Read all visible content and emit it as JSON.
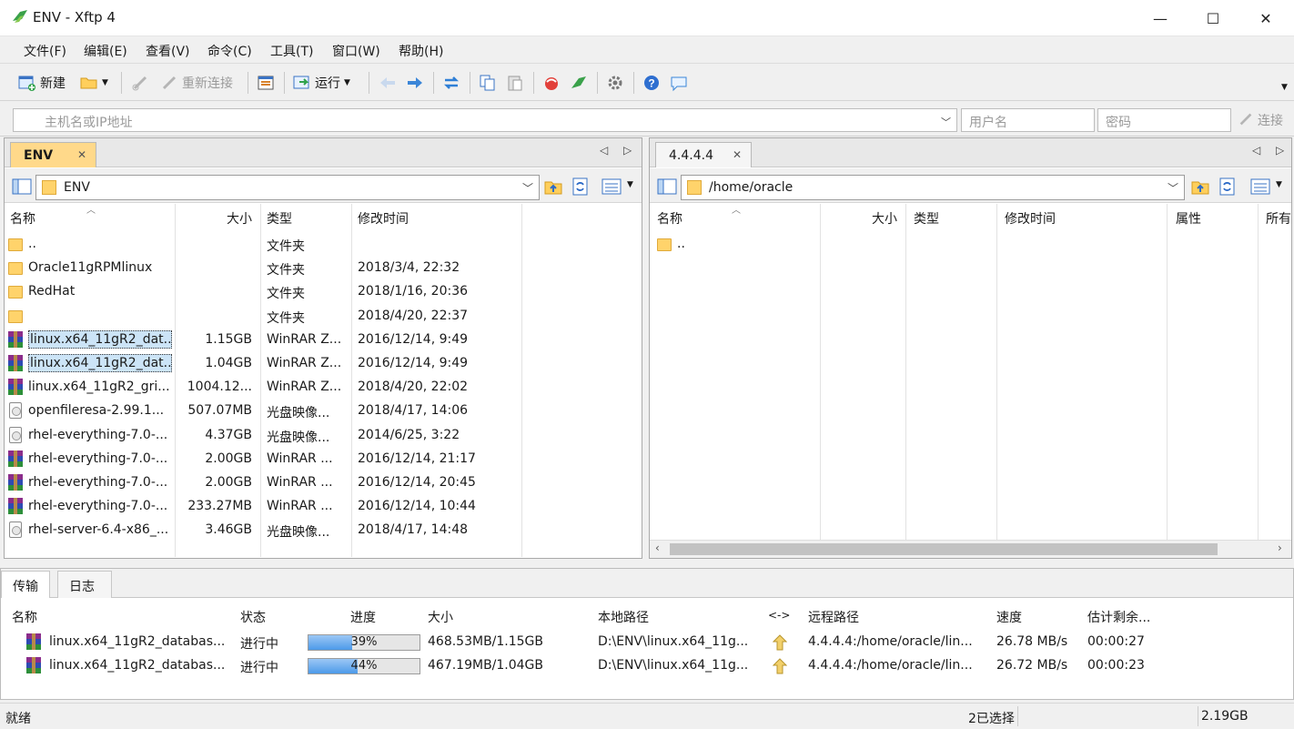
{
  "window": {
    "title": "ENV - Xftp 4",
    "minimize": "—",
    "maximize": "☐",
    "close": "✕"
  },
  "menu": [
    "文件(F)",
    "编辑(E)",
    "查看(V)",
    "命令(C)",
    "工具(T)",
    "窗口(W)",
    "帮助(H)"
  ],
  "toolbar": {
    "new_label": "新建",
    "reconnect_label": "重新连接",
    "run_label": "运行"
  },
  "address": {
    "host_placeholder": "主机名或IP地址",
    "user_placeholder": "用户名",
    "password_placeholder": "密码",
    "connect_label": "连接"
  },
  "left_pane": {
    "tab_label": "ENV",
    "path": "ENV",
    "columns": [
      "名称",
      "大小",
      "类型",
      "修改时间"
    ],
    "rows": [
      {
        "icon": "folder",
        "name": "..",
        "size": "",
        "type": "文件夹",
        "mtime": ""
      },
      {
        "icon": "folder",
        "name": "Oracle11gRPMlinux",
        "size": "",
        "type": "文件夹",
        "mtime": "2018/3/4, 22:32"
      },
      {
        "icon": "folder",
        "name": "RedHat",
        "size": "",
        "type": "文件夹",
        "mtime": "2018/1/16, 20:36"
      },
      {
        "icon": "folder",
        "name": "",
        "size": "",
        "type": "文件夹",
        "mtime": "2018/4/20, 22:37"
      },
      {
        "icon": "rar",
        "name": "linux.x64_11gR2_dat...",
        "size": "1.15GB",
        "type": "WinRAR Z...",
        "mtime": "2016/12/14, 9:49"
      },
      {
        "icon": "rar",
        "name": "linux.x64_11gR2_dat...",
        "size": "1.04GB",
        "type": "WinRAR Z...",
        "mtime": "2016/12/14, 9:49"
      },
      {
        "icon": "rar",
        "name": "linux.x64_11gR2_gri...",
        "size": "1004.12...",
        "type": "WinRAR Z...",
        "mtime": "2018/4/20, 22:02"
      },
      {
        "icon": "iso",
        "name": "openfileresa-2.99.1...",
        "size": "507.07MB",
        "type": "光盘映像...",
        "mtime": "2018/4/17, 14:06"
      },
      {
        "icon": "iso",
        "name": "rhel-everything-7.0-...",
        "size": "4.37GB",
        "type": "光盘映像...",
        "mtime": "2014/6/25, 3:22"
      },
      {
        "icon": "rar",
        "name": "rhel-everything-7.0-...",
        "size": "2.00GB",
        "type": "WinRAR ...",
        "mtime": "2016/12/14, 21:17"
      },
      {
        "icon": "rar",
        "name": "rhel-everything-7.0-...",
        "size": "2.00GB",
        "type": "WinRAR ...",
        "mtime": "2016/12/14, 20:45"
      },
      {
        "icon": "rar",
        "name": "rhel-everything-7.0-...",
        "size": "233.27MB",
        "type": "WinRAR ...",
        "mtime": "2016/12/14, 10:44"
      },
      {
        "icon": "iso",
        "name": "rhel-server-6.4-x86_...",
        "size": "3.46GB",
        "type": "光盘映像...",
        "mtime": "2018/4/17, 14:48"
      }
    ]
  },
  "right_pane": {
    "tab_label": "4.4.4.4",
    "path": "/home/oracle",
    "columns": [
      "名称",
      "大小",
      "类型",
      "修改时间",
      "属性",
      "所有"
    ],
    "rows": [
      {
        "icon": "folder",
        "name": ".."
      }
    ]
  },
  "transfer": {
    "tabs": [
      "传输",
      "日志"
    ],
    "columns": [
      "名称",
      "状态",
      "进度",
      "大小",
      "本地路径",
      "<->",
      "远程路径",
      "速度",
      "估计剩余..."
    ],
    "rows": [
      {
        "name": "linux.x64_11gR2_databas...",
        "status": "进行中",
        "progress_pct": 39,
        "progress_label": "39%",
        "size": "468.53MB/1.15GB",
        "local": "D:\\ENV\\linux.x64_11g...",
        "remote": "4.4.4.4:/home/oracle/lin...",
        "speed": "26.78 MB/s",
        "eta": "00:00:27"
      },
      {
        "name": "linux.x64_11gR2_databas...",
        "status": "进行中",
        "progress_pct": 44,
        "progress_label": "44%",
        "size": "467.19MB/1.04GB",
        "local": "D:\\ENV\\linux.x64_11g...",
        "remote": "4.4.4.4:/home/oracle/lin...",
        "speed": "26.72 MB/s",
        "eta": "00:00:23"
      }
    ]
  },
  "status": {
    "left": "就绪",
    "selection": "2已选择",
    "size": "2.19GB"
  }
}
